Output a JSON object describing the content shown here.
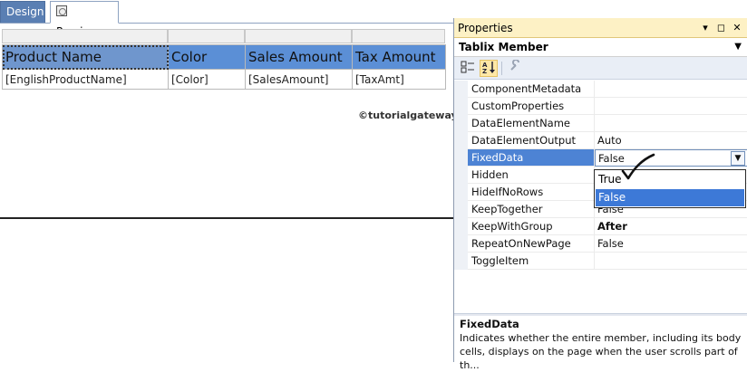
{
  "tabs": {
    "design": "Design",
    "preview": "Preview"
  },
  "report": {
    "headers": [
      "Product Name",
      "Color",
      "Sales Amount",
      "Tax Amount"
    ],
    "fields": [
      "[EnglishProductName]",
      "[Color]",
      "[SalesAmount]",
      "[TaxAmt]"
    ],
    "watermark": "©tutorialgateway.org"
  },
  "properties": {
    "title": "Properties",
    "title_buttons": [
      "▾",
      "◻",
      "✕"
    ],
    "object_name": "Tablix Member",
    "rows": [
      {
        "name": "ComponentMetadata",
        "value": ""
      },
      {
        "name": "CustomProperties",
        "value": ""
      },
      {
        "name": "DataElementName",
        "value": ""
      },
      {
        "name": "DataElementOutput",
        "value": "Auto"
      },
      {
        "name": "FixedData",
        "value": "False"
      },
      {
        "name": "Hidden",
        "value": ""
      },
      {
        "name": "HideIfNoRows",
        "value": ""
      },
      {
        "name": "KeepTogether",
        "value": "False"
      },
      {
        "name": "KeepWithGroup",
        "value": "After"
      },
      {
        "name": "RepeatOnNewPage",
        "value": "False"
      },
      {
        "name": "ToggleItem",
        "value": ""
      }
    ],
    "dropdown_options": [
      "True",
      "False"
    ],
    "selected_option": "False",
    "description_title": "FixedData",
    "description_text": "Indicates whether the entire member, including its body cells, displays on the page when the user scrolls part of th..."
  },
  "icons": {
    "categorized": "categorized-icon",
    "alphabetical": "alphabetical-sort-icon",
    "property_pages": "property-pages-icon",
    "preview_tab": "report-preview-icon"
  },
  "colors": {
    "header_bg": "#5b8fd6",
    "selection": "#4d83d4",
    "title_bar": "#fdf1c5"
  }
}
